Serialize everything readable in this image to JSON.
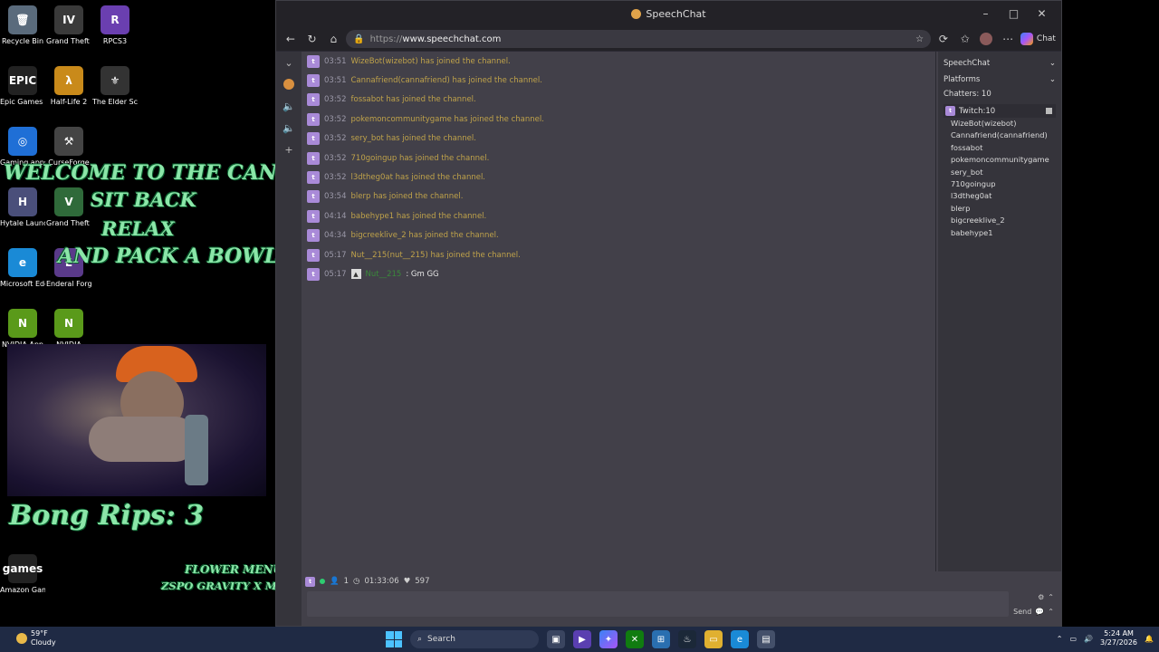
{
  "desktop": {
    "icons": [
      {
        "label": "Recycle Bin",
        "glyph": "🗑",
        "color": "#5a6b7c"
      },
      {
        "label": "Grand Theft Auto IV T...",
        "glyph": "IV",
        "color": "#3a3a3a"
      },
      {
        "label": "RPCS3",
        "glyph": "R",
        "color": "#6a3fb0"
      },
      {
        "label": "Epic Games Launcher",
        "glyph": "EPIC",
        "color": "#222"
      },
      {
        "label": "Half-Life 2",
        "glyph": "λ",
        "color": "#c98a1a"
      },
      {
        "label": "The Elder Scrolls ...",
        "glyph": "⚜",
        "color": "#333"
      },
      {
        "label": "Gaming apps",
        "glyph": "◎",
        "color": "#1f6fd6"
      },
      {
        "label": "CurseForge",
        "glyph": "⚒",
        "color": "#444"
      },
      {
        "label": "Hytale Launcher",
        "glyph": "H",
        "color": "#4a4f7a"
      },
      {
        "label": "Grand Theft Auto V",
        "glyph": "V",
        "color": "#2f6a3a"
      },
      {
        "label": "Microsoft Edge",
        "glyph": "e",
        "color": "#1a8ad6"
      },
      {
        "label": "Enderal Forgott...",
        "glyph": "E",
        "color": "#5a3a8a"
      },
      {
        "label": "NVIDIA App",
        "glyph": "N",
        "color": "#5a9a1a"
      },
      {
        "label": "NVIDIA",
        "glyph": "N",
        "color": "#5a9a1a"
      },
      {
        "label": "Amazon Games",
        "glyph": "games",
        "color": "#222"
      }
    ],
    "overlay": {
      "welcome": "WELCOME TO THE CANNA CABIN",
      "sit_back": "SIT BACK",
      "relax": "RELAX",
      "pack": "AND PACK A BOWL",
      "bong_rips": "Bong Rips: 3",
      "flower_menu": "FLOWER MENU:",
      "strain": "ZSPO GRAVITY X MAI TAI"
    }
  },
  "browser": {
    "title": "SpeechChat",
    "url_prefix": "https://",
    "url_domain": "www.speechchat.com",
    "chat_label": "Chat"
  },
  "chat": {
    "messages": [
      {
        "time": "03:51",
        "text": "WizeBot(wizebot) has joined the channel."
      },
      {
        "time": "03:51",
        "text": "Cannafriend(cannafriend) has joined the channel."
      },
      {
        "time": "03:52",
        "text": "fossabot has joined the channel."
      },
      {
        "time": "03:52",
        "text": "pokemoncommunitygame has joined the channel."
      },
      {
        "time": "03:52",
        "text": "sery_bot has joined the channel."
      },
      {
        "time": "03:52",
        "text": "710goingup has joined the channel."
      },
      {
        "time": "03:52",
        "text": "l3dtheg0at has joined the channel."
      },
      {
        "time": "03:54",
        "text": "blerp has joined the channel."
      },
      {
        "time": "04:14",
        "text": "babehype1 has joined the channel."
      },
      {
        "time": "04:34",
        "text": "bigcreeklive_2 has joined the channel."
      },
      {
        "time": "05:17",
        "text": "Nut__215(nut__215) has joined the channel."
      }
    ],
    "user_message": {
      "time": "05:17",
      "username": "Nut__215",
      "text": ": Gm GG"
    },
    "status": {
      "viewers": "1",
      "uptime": "01:33:06",
      "likes": "597"
    },
    "send_label": "Send"
  },
  "panel": {
    "speechchat": "SpeechChat",
    "platforms": "Platforms",
    "chatters": "Chatters: 10",
    "twitch": "Twitch:10",
    "chatter_list": [
      "WizeBot(wizebot)",
      "Cannafriend(cannafriend)",
      "fossabot",
      "pokemoncommunitygame",
      "sery_bot",
      "710goingup",
      "l3dtheg0at",
      "blerp",
      "bigcreeklive_2",
      "babehype1"
    ]
  },
  "taskbar": {
    "temp": "59°F",
    "condition": "Cloudy",
    "search": "Search",
    "time": "5:24 AM",
    "date": "3/27/2026"
  }
}
